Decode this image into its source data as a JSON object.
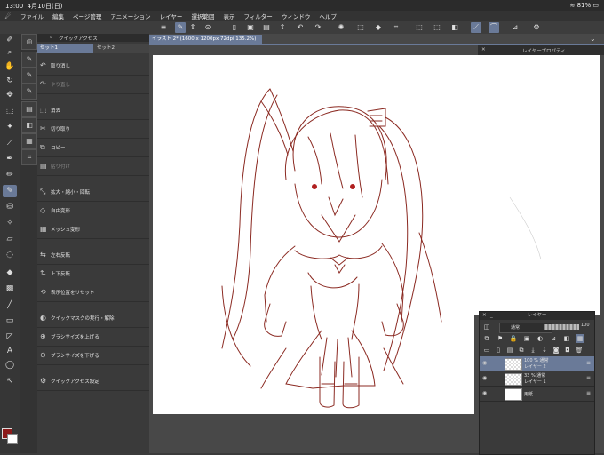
{
  "status": {
    "time": "13:00",
    "date": "4月10日(日)",
    "battery": "81%"
  },
  "menu": [
    "ファイル",
    "編集",
    "ページ管理",
    "アニメーション",
    "レイヤー",
    "選択範囲",
    "表示",
    "フィルター",
    "ウィンドウ",
    "ヘルプ"
  ],
  "quick_access": {
    "title": "クイックアクセス",
    "tabs": [
      "セット1",
      "セット2"
    ],
    "items": [
      {
        "label": "取り消し",
        "icon": "undo-icon",
        "glyph": "↶",
        "enabled": true
      },
      {
        "label": "やり直し",
        "icon": "redo-icon",
        "glyph": "↷",
        "enabled": false
      },
      {
        "label": "消去",
        "icon": "clear-icon",
        "glyph": "⬚",
        "enabled": true
      },
      {
        "label": "切り取り",
        "icon": "cut-icon",
        "glyph": "✂",
        "enabled": true
      },
      {
        "label": "コピー",
        "icon": "copy-icon",
        "glyph": "⧉",
        "enabled": true
      },
      {
        "label": "貼り付け",
        "icon": "paste-icon",
        "glyph": "▤",
        "enabled": false
      },
      {
        "label": "拡大・縮小・回転",
        "icon": "scale-icon",
        "glyph": "⤡",
        "enabled": true
      },
      {
        "label": "自由変形",
        "icon": "free-transform-icon",
        "glyph": "◇",
        "enabled": true
      },
      {
        "label": "メッシュ変形",
        "icon": "mesh-icon",
        "glyph": "▦",
        "enabled": true
      },
      {
        "label": "左右反転",
        "icon": "flip-h-icon",
        "glyph": "⇆",
        "enabled": true
      },
      {
        "label": "上下反転",
        "icon": "flip-v-icon",
        "glyph": "⇅",
        "enabled": true
      },
      {
        "label": "表示位置をリセット",
        "icon": "reset-view-icon",
        "glyph": "⟲",
        "enabled": true
      },
      {
        "label": "クイックマスクの実行・解除",
        "icon": "quickmask-icon",
        "glyph": "◐",
        "enabled": true
      },
      {
        "label": "ブラシサイズを上げる",
        "icon": "brush-up-icon",
        "glyph": "⊕",
        "enabled": true
      },
      {
        "label": "ブラシサイズを下げる",
        "icon": "brush-down-icon",
        "glyph": "⊖",
        "enabled": true
      },
      {
        "label": "クイックアクセス設定",
        "icon": "settings-icon",
        "glyph": "⚙",
        "enabled": true
      }
    ]
  },
  "document": {
    "tab_label": "イラスト 2* (1600 x 1200px 72dpi 135.2%)"
  },
  "layer_property": {
    "title": "レイヤープロパティ"
  },
  "layer_panel": {
    "title": "レイヤー",
    "blend_mode": "通常",
    "opacity": "100",
    "layers": [
      {
        "opacity_mode": "100 % 通常",
        "name": "レイヤー 2",
        "selected": true
      },
      {
        "opacity_mode": "33 % 通常",
        "name": "レイヤー 1",
        "selected": false
      },
      {
        "opacity_mode": "",
        "name": "用紙",
        "selected": false
      }
    ]
  },
  "colors": {
    "accent": "#6a7a98",
    "main_color": "#8b1a1a",
    "sub_color": "#ffffff",
    "sketch_line": "#8b2a22"
  }
}
